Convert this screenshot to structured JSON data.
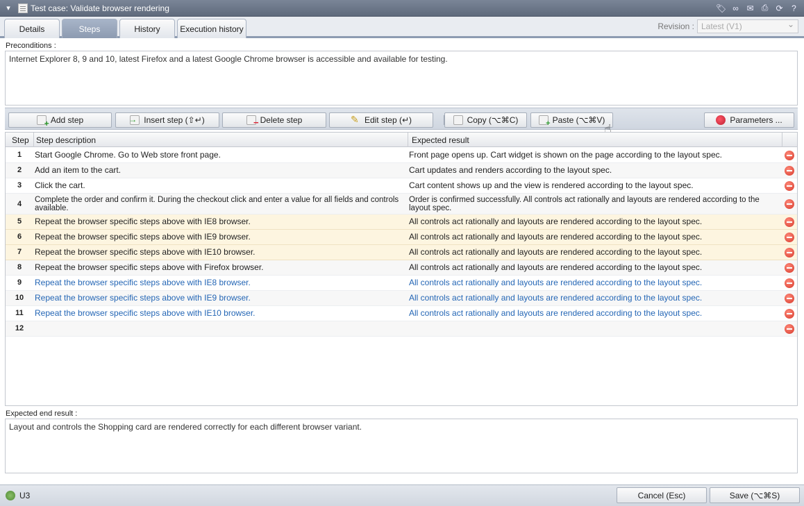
{
  "window": {
    "title": "Test case: Validate browser rendering"
  },
  "tabs": [
    "Details",
    "Steps",
    "History",
    "Execution history"
  ],
  "revision": {
    "label": "Revision :",
    "value": "Latest (V1)"
  },
  "preconditions": {
    "label": "Preconditions :",
    "text": "Internet Explorer 8, 9 and 10, latest Firefox and a latest Google Chrome browser is accessible and available for testing."
  },
  "toolbar": {
    "add": "Add step",
    "insert": "Insert step (⇧↵)",
    "delete": "Delete step",
    "edit": "Edit step (↵)",
    "copy": "Copy (⌥⌘C)",
    "paste": "Paste (⌥⌘V)",
    "parameters": "Parameters ..."
  },
  "grid": {
    "headers": {
      "step": "Step",
      "description": "Step description",
      "expected": "Expected result"
    },
    "rows": [
      {
        "num": "1",
        "desc": "Start Google Chrome. Go to Web store front page.",
        "exp": "Front page opens up. Cart widget is shown on the page according to the layout spec."
      },
      {
        "num": "2",
        "desc": "Add an item to the cart.",
        "exp": "Cart updates and renders according to the layout spec."
      },
      {
        "num": "3",
        "desc": "Click the cart.",
        "exp": "Cart content shows up and the view is rendered according to the layout spec."
      },
      {
        "num": "4",
        "desc": "Complete the order and confirm it. During the checkout click and enter a value for all fields and controls available.",
        "exp": "Order is confirmed successfully. All controls act rationally and layouts are rendered according to the layout spec."
      },
      {
        "num": "5",
        "desc": "Repeat the browser specific steps above with IE8 browser.",
        "exp": "All controls act rationally and layouts are rendered according to the layout spec."
      },
      {
        "num": "6",
        "desc": "Repeat the browser specific steps above with IE9 browser.",
        "exp": "All controls act rationally and layouts are rendered according to the layout spec."
      },
      {
        "num": "7",
        "desc": "Repeat the browser specific steps above with IE10 browser.",
        "exp": "All controls act rationally and layouts are rendered according to the layout spec."
      },
      {
        "num": "8",
        "desc": "Repeat the browser specific steps above with Firefox browser.",
        "exp": "All controls act rationally and layouts are rendered according to the layout spec."
      },
      {
        "num": "9",
        "desc": "Repeat the browser specific steps above with IE8 browser.",
        "exp": "All controls act rationally and layouts are rendered according to the layout spec."
      },
      {
        "num": "10",
        "desc": "Repeat the browser specific steps above with IE9 browser.",
        "exp": "All controls act rationally and layouts are rendered according to the layout spec."
      },
      {
        "num": "11",
        "desc": "Repeat the browser specific steps above with IE10 browser.",
        "exp": "All controls act rationally and layouts are rendered according to the layout spec."
      },
      {
        "num": "12",
        "desc": "",
        "exp": ""
      }
    ]
  },
  "end_result": {
    "label": "Expected end result :",
    "text": "Layout and controls the Shopping card are rendered correctly for each different browser variant."
  },
  "status": {
    "project": "U3",
    "cancel": "Cancel (Esc)",
    "save": "Save (⌥⌘S)"
  },
  "colors": {
    "titlebar": "#6b7689",
    "link": "#2466b5",
    "highlight_row": "#fdf5e0",
    "active_tab": "#8d9bb1"
  }
}
